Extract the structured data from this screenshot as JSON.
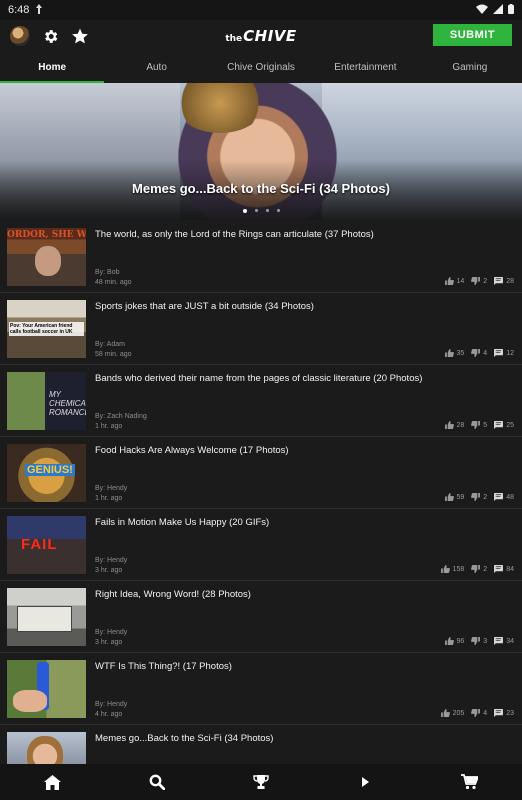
{
  "status_bar": {
    "time": "6:48",
    "icons": [
      "notification-icon",
      "wifi-icon",
      "signal-icon",
      "battery-icon"
    ]
  },
  "app_bar": {
    "logo_prefix": "the",
    "logo_name": "CHIVE",
    "submit_label": "SUBMIT",
    "accent_color": "#2fb53d",
    "icons": [
      "avatar",
      "gear-icon",
      "star-icon"
    ]
  },
  "tabs": [
    {
      "label": "Home",
      "active": true
    },
    {
      "label": "Auto",
      "active": false
    },
    {
      "label": "Chive Originals",
      "active": false
    },
    {
      "label": "Entertainment",
      "active": false
    },
    {
      "label": "Gaming",
      "active": false
    }
  ],
  "hero": {
    "title": "Memes go...Back to the Sci-Fi (34 Photos)",
    "slide_count": 4,
    "active_slide": 1
  },
  "posts": [
    {
      "title": "The world, as only the Lord of the Rings can articulate (37 Photos)",
      "author": "By: Bob",
      "time": "48 min. ago",
      "likes": "14",
      "dislikes": "2",
      "comments": "28",
      "thumb_text": "ORDOR, SHE WRO"
    },
    {
      "title": "Sports jokes that are JUST a bit outside (34 Photos)",
      "author": "By: Adam",
      "time": "58 min. ago",
      "likes": "35",
      "dislikes": "4",
      "comments": "12",
      "thumb_text": "Pov: Your American friend calls football soccer in UK"
    },
    {
      "title": "Bands who derived their name from the pages of classic literature (20 Photos)",
      "author": "By: Zach Nading",
      "time": "1 hr. ago",
      "likes": "28",
      "dislikes": "5",
      "comments": "25",
      "thumb_text": "MY CHEMICAL ROMANCE"
    },
    {
      "title": "Food Hacks Are Always Welcome (17 Photos)",
      "author": "By: Hendy",
      "time": "1 hr. ago",
      "likes": "59",
      "dislikes": "2",
      "comments": "48",
      "thumb_text": "GENIUS!"
    },
    {
      "title": "Fails in Motion Make Us Happy (20 GIFs)",
      "author": "By: Hendy",
      "time": "3 hr. ago",
      "likes": "158",
      "dislikes": "2",
      "comments": "84",
      "thumb_text": "FAIL"
    },
    {
      "title": "Right Idea, Wrong Word! (28 Photos)",
      "author": "By: Hendy",
      "time": "3 hr. ago",
      "likes": "96",
      "dislikes": "3",
      "comments": "34",
      "thumb_text": ""
    },
    {
      "title": "WTF Is This Thing?! (17 Photos)",
      "author": "By: Hendy",
      "time": "4 hr. ago",
      "likes": "205",
      "dislikes": "4",
      "comments": "23",
      "thumb_text": ""
    },
    {
      "title": "Memes go...Back to the Sci-Fi (34 Photos)",
      "author": "",
      "time": "",
      "likes": "",
      "dislikes": "",
      "comments": "",
      "thumb_text": ""
    }
  ],
  "bottom_nav": [
    {
      "icon": "home-icon"
    },
    {
      "icon": "search-icon"
    },
    {
      "icon": "trophy-icon"
    },
    {
      "icon": "play-icon"
    },
    {
      "icon": "cart-icon"
    }
  ]
}
